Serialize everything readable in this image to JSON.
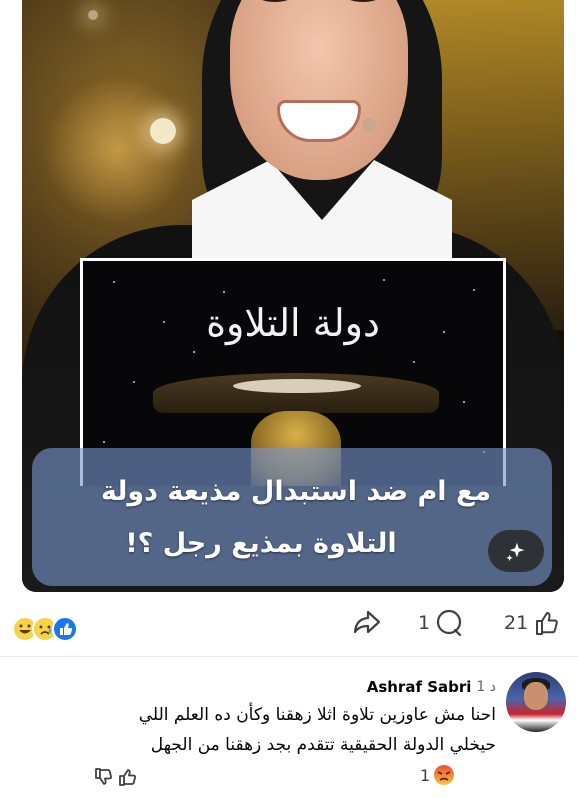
{
  "post": {
    "headline_line1": "مع ام  ضد استبدال مذيعة دولة",
    "headline_line2": "التلاوة بمذيع رجل ؟!",
    "show_logo_text": "دولة التلاوة"
  },
  "actions": {
    "reaction_icons": [
      "haha-icon",
      "sad-icon",
      "like-icon"
    ],
    "share_icon": "share-icon",
    "comment_count": "1",
    "like_count": "21"
  },
  "comment": {
    "author": "Ashraf Sabri",
    "time": "1 د",
    "text_line1": "احنا مش عاوزين تلاوة اثلا زهقنا وكأن ده العلم اللي",
    "text_line2": "حيخلي الدولة الحقيقية تتقدم بجد زهقنا من الجهل",
    "reaction_count": "1",
    "reaction_icon": "angry-icon"
  },
  "colors": {
    "accent_blue": "#1877f2",
    "secondary_text": "#65676b",
    "headline_overlay": "#7896cd"
  }
}
